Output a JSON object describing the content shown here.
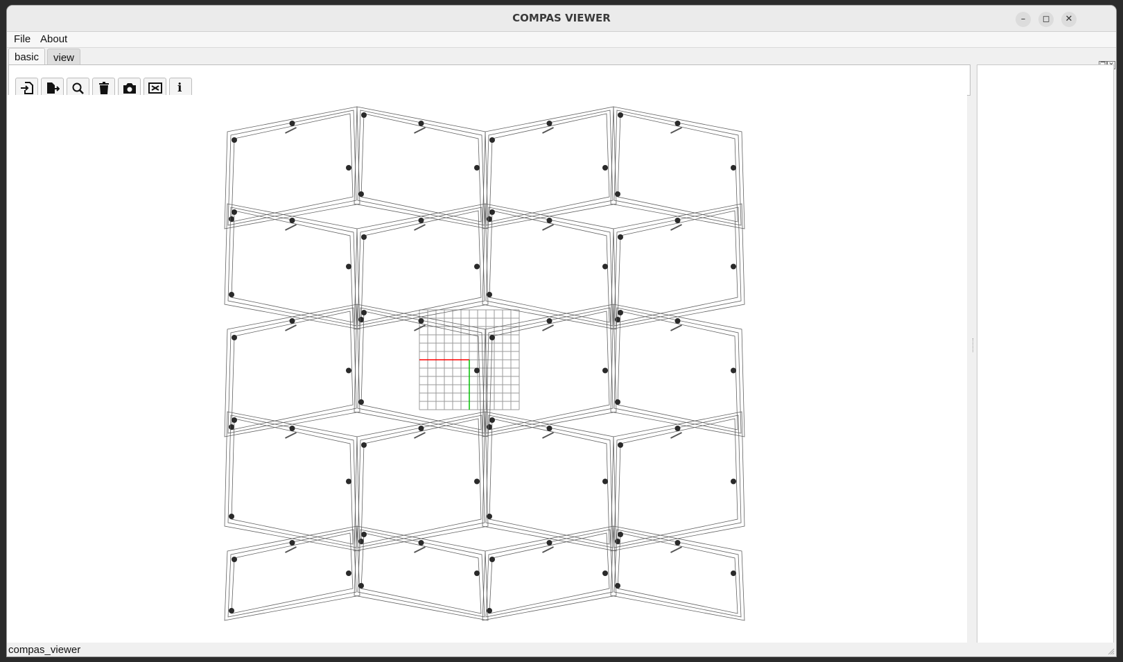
{
  "window": {
    "title": "COMPAS VIEWER"
  },
  "menubar": {
    "items": [
      "File",
      "About"
    ]
  },
  "tabs": [
    "basic",
    "view"
  ],
  "toolbar": {
    "tools": [
      "import-icon",
      "export-icon",
      "search-icon",
      "trash-icon",
      "camera-icon",
      "fit-view-icon",
      "info-icon"
    ],
    "info_glyph": "i"
  },
  "viewport": {
    "scene": "top view of quad-panel timber frame mesh with grid and world axes"
  },
  "statusbar": {
    "text": "compas_viewer"
  },
  "colors": {
    "x_axis": "#ff0000",
    "y_axis": "#00c000",
    "grid": "#9a9a9a",
    "frame_lines": "#606060",
    "joints": "#2a2a2a"
  }
}
